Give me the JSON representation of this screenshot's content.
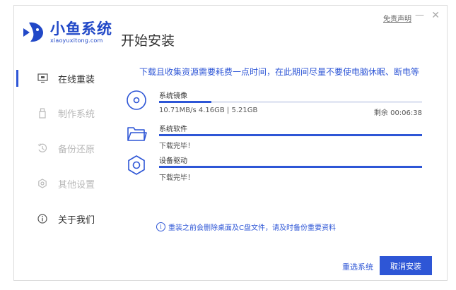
{
  "window": {
    "minimize": "—",
    "close": "✕"
  },
  "brand": {
    "name": "小鱼系统",
    "url": "xiaoyuxitong.com"
  },
  "header": {
    "title": "开始安装",
    "disclaimer": "免责声明"
  },
  "sidebar": {
    "items": [
      {
        "label": "在线重装",
        "icon": "monitor-icon",
        "state": "active"
      },
      {
        "label": "制作系统",
        "icon": "usb-icon",
        "state": "disabled"
      },
      {
        "label": "备份还原",
        "icon": "restore-icon",
        "state": "disabled"
      },
      {
        "label": "其他设置",
        "icon": "settings-icon",
        "state": "disabled"
      },
      {
        "label": "关于我们",
        "icon": "info-icon",
        "state": "normal"
      }
    ]
  },
  "main": {
    "notice": "下载且收集资源需要耗费一点时间，在此期间尽量不要使电脑休眠、断电等",
    "tasks": [
      {
        "name": "系统镜像",
        "icon": "disc-icon",
        "progress": 0.2,
        "stat": "10.71MB/s 4.16GB | 5.21GB",
        "remaining": "剩余 00:06:38"
      },
      {
        "name": "系统软件",
        "icon": "folder-icon",
        "progress": 1.0,
        "stat": "下载完毕！"
      },
      {
        "name": "设备驱动",
        "icon": "gear-icon",
        "progress": 1.0,
        "stat": "下载完毕！"
      }
    ],
    "tip": "重装之前会删除桌面及C盘文件，请及时备份重要资料",
    "tip_icon": "i"
  },
  "footer": {
    "reselect": "重选系统",
    "cancel": "取消安装"
  },
  "colors": {
    "accent": "#2e56d6",
    "brand": "#2148c7",
    "disabled": "#b8b8b8"
  }
}
